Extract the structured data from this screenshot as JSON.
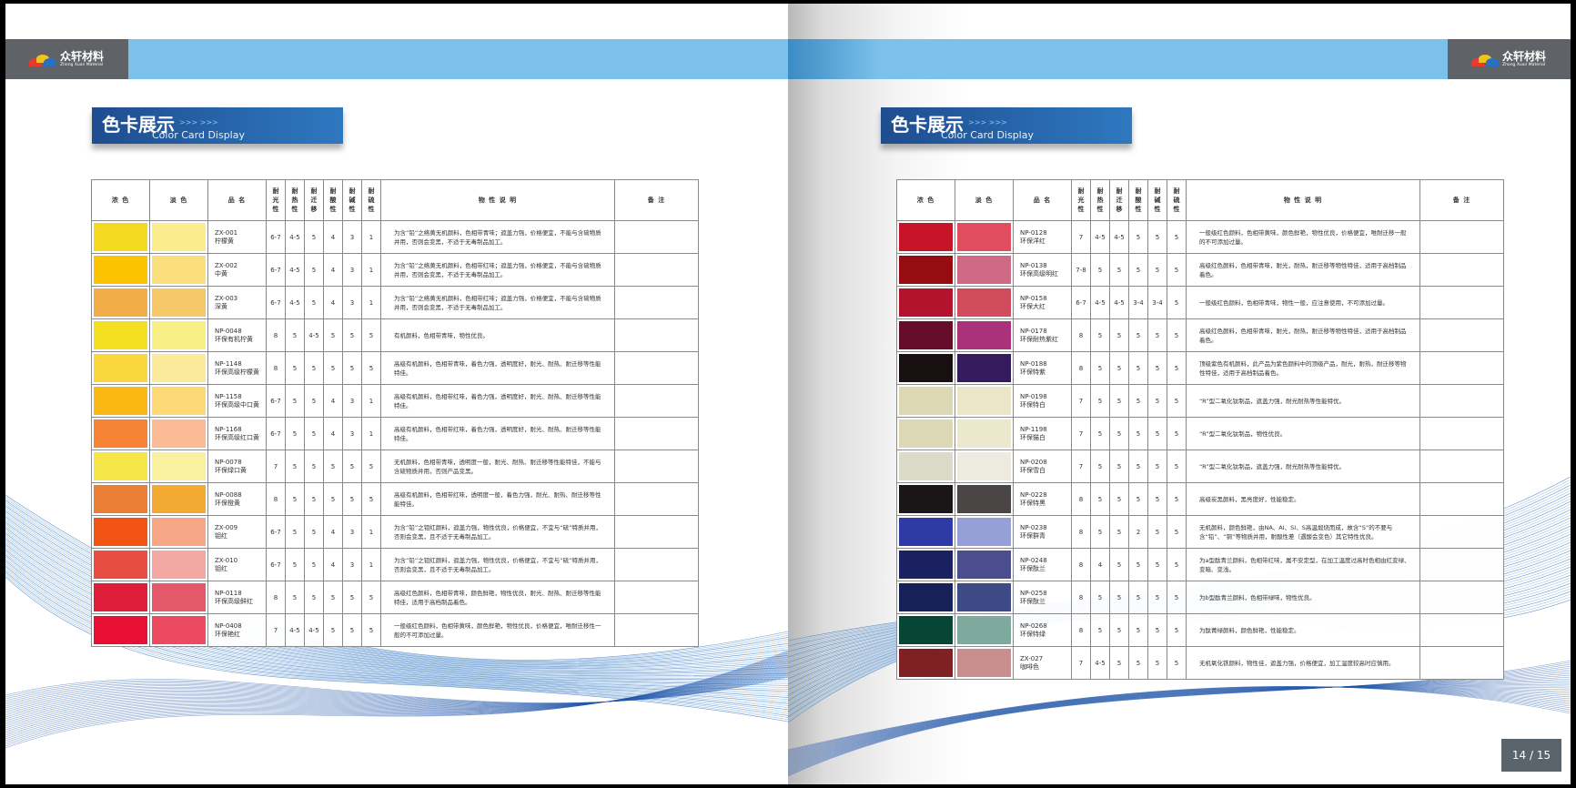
{
  "brand": {
    "cn": "众轩材料",
    "en": "Zhong Xuan Material"
  },
  "banner": {
    "cn": "色卡展示",
    "arrows": ">>> >>>",
    "en": "Color Card Display"
  },
  "headers": [
    "浓 色",
    "淡 色",
    "品 名",
    "耐光性",
    "耐热性",
    "耐迁移",
    "耐酸性",
    "耐碱性",
    "耐硫性",
    "物 性 说 明",
    "备 注"
  ],
  "left_rows": [
    {
      "dark": "#f3d91f",
      "light": "#fbec8e",
      "code": "ZX-001",
      "name": "柠檬黄",
      "r": [
        "6-7",
        "4-5",
        "5",
        "4",
        "3",
        "1"
      ],
      "desc": "为含“铅”之络黄无机颜料，色相带青味；遮盖力强，价格便宜，不能与含硫物质并用，否则会变黑，不适于无毒制品加工。"
    },
    {
      "dark": "#fcc300",
      "light": "#fbdf7f",
      "code": "ZX-002",
      "name": "中黄",
      "r": [
        "6-7",
        "4-5",
        "5",
        "4",
        "3",
        "1"
      ],
      "desc": "为含“铅”之络黄无机颜料，色相带红味；遮盖力强，价格便宜，不能与含硫物质并用，否则会变黑，不适于无毒制品加工。"
    },
    {
      "dark": "#f2ad48",
      "light": "#f7c868",
      "code": "ZX-003",
      "name": "深黄",
      "r": [
        "6-7",
        "4-5",
        "5",
        "4",
        "3",
        "1"
      ],
      "desc": "为含“铅”之络黄无机颜料，色相带红味；遮盖力强，价格便宜，不能与含硫物质并用，否则会变黑，不适于无毒制品加工。"
    },
    {
      "dark": "#f4e021",
      "light": "#f8ef86",
      "code": "NP-0048",
      "name": "环保有机柠黄",
      "r": [
        "8",
        "5",
        "4-5",
        "5",
        "5",
        "5"
      ],
      "desc": "有机颜料，色相带青味，物性优良。"
    },
    {
      "dark": "#fad73d",
      "light": "#fcea9b",
      "code": "NP-1148",
      "name": "环保高级柠檬黄",
      "r": [
        "8",
        "5",
        "5",
        "5",
        "5",
        "5"
      ],
      "desc": "高级有机颜料，色相带青味，着色力强，透明度好，耐光、耐热、耐迁移等性能特佳。"
    },
    {
      "dark": "#fcb812",
      "light": "#fdd976",
      "code": "NP-1158",
      "name": "环保高级中口黄",
      "r": [
        "6-7",
        "5",
        "5",
        "4",
        "3",
        "1"
      ],
      "desc": "高级有机颜料，色相带红味，着色力强，透明度好，耐光、耐热、耐迁移等性能特佳。"
    },
    {
      "dark": "#f78334",
      "light": "#fbbb95",
      "code": "NP-1168",
      "name": "环保高级红口黄",
      "r": [
        "6-7",
        "5",
        "5",
        "4",
        "3",
        "1"
      ],
      "desc": "高级有机颜料，色相带红味，着色力强，透明度好，耐光、耐热、耐迁移等性能特佳。"
    },
    {
      "dark": "#f5e547",
      "light": "#f9f19e",
      "code": "NP-0078",
      "name": "环保绿口黄",
      "r": [
        "7",
        "5",
        "5",
        "5",
        "5",
        "5"
      ],
      "desc": "无机颜料，色相带青味，透明度一般，耐光、耐热、耐迁移等性能特佳，不能与含硫物质并用，否则产品变黑。"
    },
    {
      "dark": "#ea7e35",
      "light": "#f2aa32",
      "code": "NP-0088",
      "name": "环保橙黄",
      "r": [
        "8",
        "5",
        "5",
        "5",
        "5",
        "5"
      ],
      "desc": "高级有机颜料，色相带红味，透明度一般，着色力强，耐光、耐热、耐迁移等性能特佳。"
    },
    {
      "dark": "#f05312",
      "light": "#f7a786",
      "code": "ZX-009",
      "name": "钼红",
      "r": [
        "6-7",
        "5",
        "5",
        "4",
        "3",
        "1"
      ],
      "desc": "为含“铅”之钼红颜料，遮盖力强，物性优良，价格便宜，不宜与“硫”特质并用，否则会变黑，且不适于无毒制品加工。"
    },
    {
      "dark": "#e84d41",
      "light": "#f3a8a3",
      "code": "ZX-010",
      "name": "钼红",
      "r": [
        "6-7",
        "5",
        "5",
        "4",
        "3",
        "1"
      ],
      "desc": "为含“铅”之钼红颜料，遮盖力强，物性优良，价格便宜，不宜与“硫”特质并用，否则会变黑，且不适于无毒制品加工。"
    },
    {
      "dark": "#dd1d3a",
      "light": "#e4586a",
      "code": "NP-0118",
      "name": "环保高级鲜红",
      "r": [
        "8",
        "5",
        "5",
        "5",
        "5",
        "5"
      ],
      "desc": "高级红色颜料，色相带青味，颜色鲜艳，物性优良，耐光、耐热、耐迁移等性能特佳，适用于高档制品着色。"
    },
    {
      "dark": "#e80f34",
      "light": "#ec4a60",
      "code": "NP-0408",
      "name": "环保艳红",
      "r": [
        "7",
        "4-5",
        "4-5",
        "5",
        "5",
        "5"
      ],
      "desc": "一般级红色颜料，色相带黄味，颜色鲜艳，物性优良，价格便宜，唯耐迁移性一般的不可添加过量。"
    }
  ],
  "right_rows": [
    {
      "dark": "#c71428",
      "light": "#df4d5f",
      "code": "NP-0128",
      "name": "环保洋红",
      "r": [
        "7",
        "4-5",
        "4-5",
        "5",
        "5",
        "5"
      ],
      "desc": "一般级红色颜料，色相带黄味，颜色鲜艳，物性优良，价格便宜，唯耐迁移一般的不可添加过量。"
    },
    {
      "dark": "#960c10",
      "light": "#ce6a86",
      "code": "NP-0138",
      "name": "环保高级明红",
      "r": [
        "7-8",
        "5",
        "5",
        "5",
        "5",
        "5"
      ],
      "desc": "高级红色颜料，色相带青味，耐光，耐热，耐迁移等物性特佳，适用于高档制品着色。"
    },
    {
      "dark": "#b3132d",
      "light": "#d04c5d",
      "code": "NP-0158",
      "name": "环保大红",
      "r": [
        "6-7",
        "4-5",
        "4-5",
        "3-4",
        "3-4",
        "5"
      ],
      "desc": "一般级红色颜料，色相带青味，物性一般，应注意使用，不可添加过量。"
    },
    {
      "dark": "#650d2a",
      "light": "#a9327a",
      "code": "NP-0178",
      "name": "环保耐热紫红",
      "r": [
        "8",
        "5",
        "5",
        "5",
        "5",
        "5"
      ],
      "desc": "高级红色颜料，色相带青味，耐光，耐热，耐迁移等物性特佳，适用于高档制品着色。"
    },
    {
      "dark": "#180f10",
      "light": "#351a5e",
      "code": "NP-0188",
      "name": "环保特紫",
      "r": [
        "8",
        "5",
        "5",
        "5",
        "5",
        "5"
      ],
      "desc": "顶级紫色有机颜料，此产品为紫色颜料中的顶级产品，耐光，耐热，耐迁移等物性特佳，适用于高档制品着色。"
    },
    {
      "dark": "#dcd8b3",
      "light": "#ece7c8",
      "code": "NP-0198",
      "name": "环保特白",
      "r": [
        "7",
        "5",
        "5",
        "5",
        "5",
        "5"
      ],
      "desc": "“R”型二氧化钛制品，遮盖力强，耐光耐热等性能特优。"
    },
    {
      "dark": "#dcd8b6",
      "light": "#ece8cd",
      "code": "NP-1198",
      "name": "环保猫白",
      "r": [
        "7",
        "5",
        "5",
        "5",
        "5",
        "5"
      ],
      "desc": "“R”型二氧化钛制品，物性优良。"
    },
    {
      "dark": "#dcdac8",
      "light": "#edebdf",
      "code": "NP-0208",
      "name": "环保雪白",
      "r": [
        "7",
        "5",
        "5",
        "5",
        "5",
        "5"
      ],
      "desc": "“R”型二氧化钛制品，遮盖力强，耐光耐热等性能特优。"
    },
    {
      "dark": "#1a1617",
      "light": "#4a4645",
      "code": "NP-0228",
      "name": "环保特黑",
      "r": [
        "8",
        "5",
        "5",
        "5",
        "5",
        "5"
      ],
      "desc": "高级炭黑颜料，黑亮度好，性能稳定。"
    },
    {
      "dark": "#303aa6",
      "light": "#979fd9",
      "code": "NP-0238",
      "name": "环保群青",
      "r": [
        "8",
        "5",
        "5",
        "2",
        "5",
        "5"
      ],
      "desc": "无机颜料，颜色鲜艳，由NA、AI、SI、S高温煅烧而成，故含“S”的不要与含“铅”、“铜”等物质并用，耐酸性差（遇酸会变色）其它特性优良。"
    },
    {
      "dark": "#1b2160",
      "light": "#4a4e8f",
      "code": "NP-0248",
      "name": "环保酞兰",
      "r": [
        "8",
        "4",
        "5",
        "5",
        "5",
        "5"
      ],
      "desc": "为a型酞青兰颜料，色相带红味，属不安定型，在加工温度过高时色相由红变绿、变暗、变浅。"
    },
    {
      "dark": "#162158",
      "light": "#3c4a85",
      "code": "NP-0258",
      "name": "环保酞兰",
      "r": [
        "8",
        "5",
        "5",
        "5",
        "5",
        "5"
      ],
      "desc": "为b型酞青兰颜料，色相带绿味，物性优良。"
    },
    {
      "dark": "#074634",
      "light": "#7ea99d",
      "code": "NP-0268",
      "name": "环保特绿",
      "r": [
        "8",
        "5",
        "5",
        "5",
        "5",
        "5"
      ],
      "desc": "为酞菁绿颜料，颜色鲜艳，性能稳定。"
    },
    {
      "dark": "#7e2024",
      "light": "#c98f8e",
      "code": "ZX-027",
      "name": "咖啡色",
      "r": [
        "7",
        "4-5",
        "5",
        "5",
        "5",
        "5"
      ],
      "desc": "无机氧化铁颜料，物性佳，遮盖力强，价格便宜，加工温度较高时应慎用。"
    }
  ],
  "page_number": "14 / 15"
}
